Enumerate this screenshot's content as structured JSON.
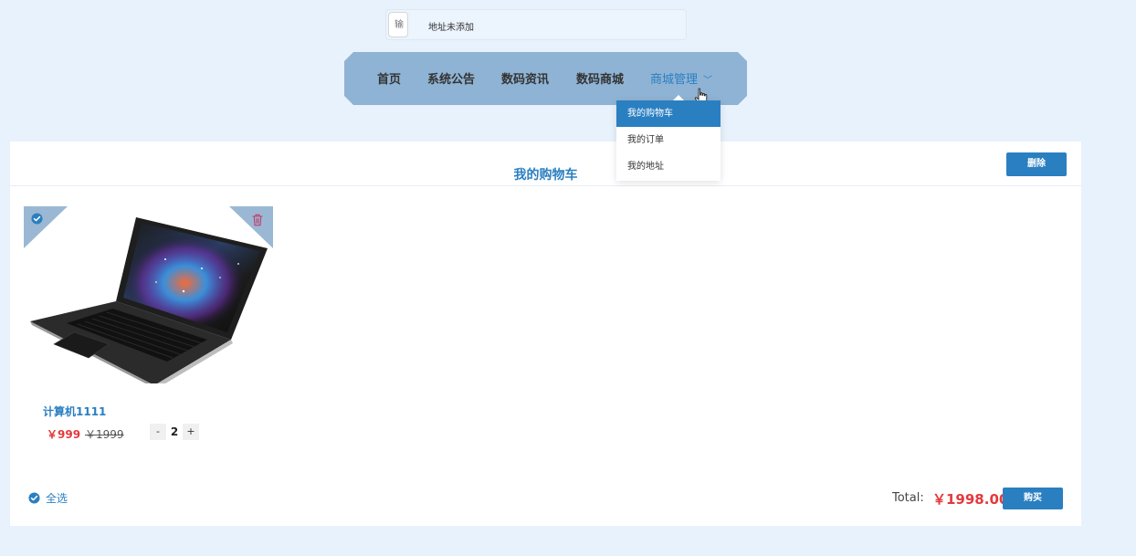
{
  "header": {
    "search_placeholder": "输",
    "address_text": "地址未添加"
  },
  "nav": {
    "items": [
      {
        "label": "首页"
      },
      {
        "label": "系统公告"
      },
      {
        "label": "数码资讯"
      },
      {
        "label": "数码商城"
      },
      {
        "label": "商城管理",
        "active": true
      }
    ],
    "dropdown": [
      {
        "label": "我的购物车",
        "selected": true
      },
      {
        "label": "我的订单"
      },
      {
        "label": "我的地址"
      }
    ]
  },
  "cart": {
    "title": "我的购物车",
    "delete_label": "删除",
    "items": [
      {
        "name": "计算机1111",
        "price": "￥999",
        "original_price": "￥1999",
        "quantity": "2",
        "checked": true
      }
    ],
    "stepper": {
      "minus": "-",
      "plus": "+"
    },
    "select_all_label": "全选",
    "total_label": "Total:",
    "total_value": "￥1998.00",
    "buy_label": "购买"
  },
  "colors": {
    "accent": "#2a7fc1",
    "price": "#e4393c",
    "nav_bg": "#8fb3d4",
    "page_bg": "#e8f2fc"
  },
  "icons": [
    "check-circle-icon",
    "trash-icon",
    "chevron-down-icon",
    "pointer-hand-icon"
  ]
}
